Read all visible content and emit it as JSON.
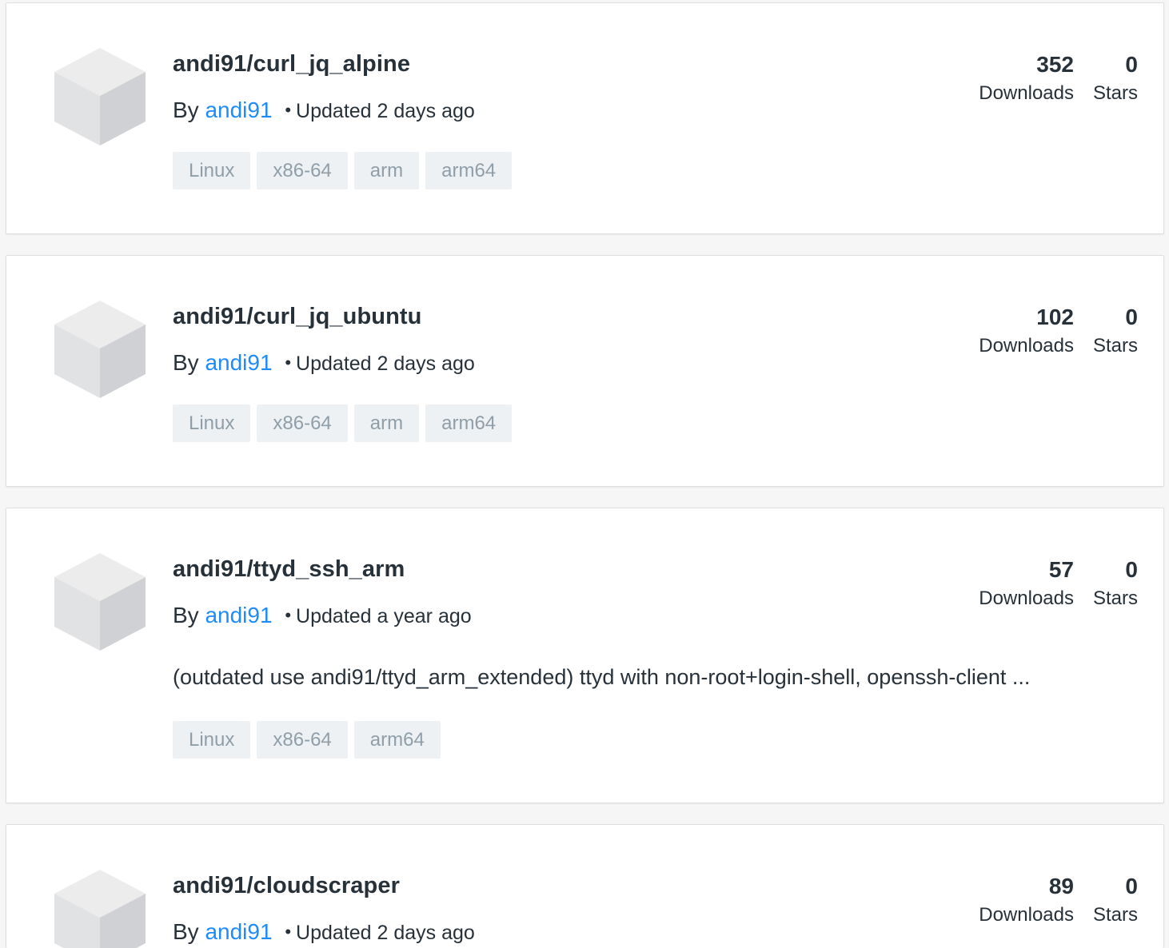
{
  "repositories": [
    {
      "name": "andi91/curl_jq_alpine",
      "by_label": "By",
      "author": "andi91",
      "updated": "Updated 2 days ago",
      "description": "",
      "tags": [
        "Linux",
        "x86-64",
        "arm",
        "arm64"
      ],
      "downloads": "352",
      "downloads_label": "Downloads",
      "stars": "0",
      "stars_label": "Stars"
    },
    {
      "name": "andi91/curl_jq_ubuntu",
      "by_label": "By",
      "author": "andi91",
      "updated": "Updated 2 days ago",
      "description": "",
      "tags": [
        "Linux",
        "x86-64",
        "arm",
        "arm64"
      ],
      "downloads": "102",
      "downloads_label": "Downloads",
      "stars": "0",
      "stars_label": "Stars"
    },
    {
      "name": "andi91/ttyd_ssh_arm",
      "by_label": "By",
      "author": "andi91",
      "updated": "Updated a year ago",
      "description": "(outdated use andi91/ttyd_arm_extended) ttyd with non-root+login-shell, openssh-client ...",
      "tags": [
        "Linux",
        "x86-64",
        "arm64"
      ],
      "downloads": "57",
      "downloads_label": "Downloads",
      "stars": "0",
      "stars_label": "Stars"
    },
    {
      "name": "andi91/cloudscraper",
      "by_label": "By",
      "author": "andi91",
      "updated": "Updated 2 days ago",
      "description": "",
      "tags": [],
      "downloads": "89",
      "downloads_label": "Downloads",
      "stars": "0",
      "stars_label": "Stars"
    }
  ],
  "colors": {
    "link": "#1d8cf8",
    "tag_bg": "#eef1f3",
    "tag_text": "#8f9ea8",
    "cube_top": "#ececec",
    "cube_left": "#e1e2e4",
    "cube_right": "#cfd1d4"
  }
}
